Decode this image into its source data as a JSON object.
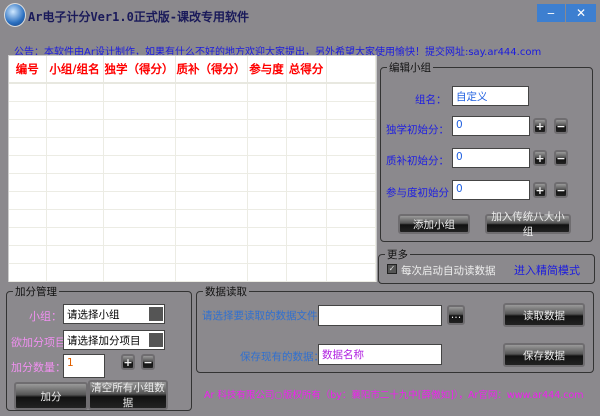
{
  "window": {
    "title": "Ar电子计分Ver1.0正式版-课改专用软件",
    "minimize": "‒",
    "close": "✕"
  },
  "notice": "公告：本软件由Ar设计制作，如果有什么不好的地方欢迎大家提出，另外希望大家使用愉快！提交网址:say.ar444.com",
  "table": {
    "headers": [
      "编号",
      "小组/组名",
      "独学（得分）",
      "质补（得分）",
      "参与度",
      "总得分"
    ]
  },
  "edit_group": {
    "title": "编辑小组",
    "name_label": "组名：",
    "name_value": "自定义",
    "solo_label": "独学初始分：",
    "solo_value": "0",
    "supp_label": "质补初始分：",
    "supp_value": "0",
    "part_label": "参与度初始分",
    "part_value": "0",
    "plus": "+",
    "minus": "−",
    "add_btn": "添加小组",
    "add8_btn": "加入传统八大小组"
  },
  "more": {
    "title": "更多",
    "auto_load": "每次启动自动读数据",
    "auto_load_checked": true,
    "simple_mode": "进入精简模式"
  },
  "score": {
    "title": "加分管理",
    "group_label": "小组：",
    "group_value": "请选择小组",
    "item_label": "欲加分项目：",
    "item_value": "请选择加分项目",
    "qty_label": "加分数量：",
    "qty_value": "1",
    "plus": "+",
    "minus": "−",
    "add_btn": "加分",
    "clear_btn": "清空所有小组数据"
  },
  "data": {
    "title": "数据读取",
    "file_label": "请选择要读取的数据文件：",
    "file_value": "",
    "browse": "…",
    "read_btn": "读取数据",
    "save_label": "保存现有的数据：",
    "save_value": "数据名称",
    "save_btn": "保存数据"
  },
  "footer": "Ar 科技有限公司○版权所有（by：襄阳市二十九中[薛傲如]），Ar官网：www.ar444.com"
}
